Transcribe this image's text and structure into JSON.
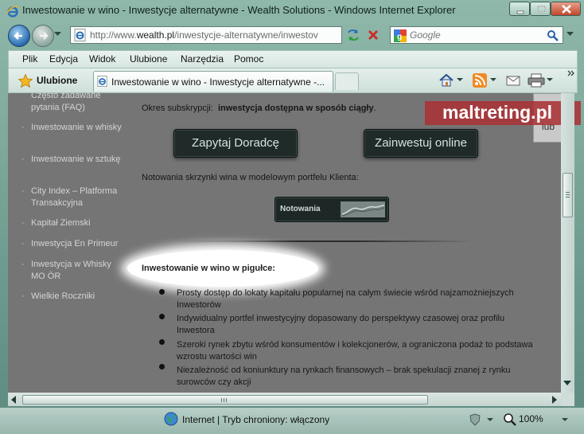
{
  "window": {
    "title": "Inwestowanie w wino - Inwestycje alternatywne - Wealth Solutions - Windows Internet Explorer"
  },
  "address_bar": {
    "prefix": "http://www.",
    "domain": "wealth.pl",
    "path": "/inwestycje-alternatywne/inwestov"
  },
  "search": {
    "placeholder": "Google"
  },
  "menu": [
    "Plik",
    "Edycja",
    "Widok",
    "Ulubione",
    "Narzędzia",
    "Pomoc"
  ],
  "favorites": {
    "label": "Ulubione",
    "tab_title": "Inwestowanie w wino - Inwestycje alternatywne -..."
  },
  "sidebar": {
    "items": [
      "Często zadawane pytania (FAQ)",
      "Inwestowanie w whisky",
      "Inwestowanie w sztukę",
      "City Index – Platforma Transakcyjna",
      "Kapitał Ziemski",
      "Inwestycja En Primeur",
      "Inwestycja w Whisky MO ÒR",
      "Wielkie Roczniki"
    ]
  },
  "main": {
    "subscription_label": "Okres subskrypcji:",
    "subscription_value": "inwestycja dostępna w sposób ciągły",
    "subscription_period": ".",
    "advisor_button": "Zapytaj Doradcę",
    "invest_button": "Zainwestuj online",
    "quotes_text": "Notowania skrzynki wina w modelowym portfelu Klienta:",
    "quotes_button": "Notowania",
    "nutshell_title": "Inwestowanie w wino w pigułce:",
    "bullets": [
      "Prosty dostęp do lokaty kapitału popularnej na całym świecie wśród najzamożniejszych Inwestorów",
      "Indywidualny portfel inwestycyjny dopasowany do perspektywy czasowej oraz profilu Inwestora",
      "Szeroki rynek zbytu wśród konsumentów i kolekcjonerów, a ograniczona podaż to podstawa wzrostu wartości win",
      "Niezależność od koniunktury na rynkach finansowych – brak spekulacji znanej z rynku surowców czy akcji"
    ]
  },
  "watermark": "maltreting.pl",
  "side_card_text": "lub",
  "status": {
    "zone": "Internet | Tryb chroniony: włączony",
    "zoom": "100%"
  },
  "colors": {
    "content_bg": "#757575",
    "button_bg": "#1f2a29",
    "watermark_bg": "#aa3237"
  }
}
